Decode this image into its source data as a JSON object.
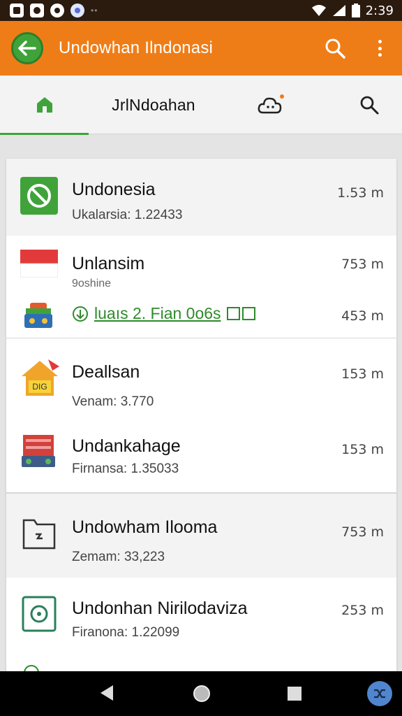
{
  "status_bar": {
    "time": "2:39"
  },
  "app_bar": {
    "title": "Undowhan Ilndonasi"
  },
  "tabs": {
    "label": "JrlNdoahan"
  },
  "items": [
    {
      "title": "Undonesia",
      "subtitle": "Ukalarsia: 1.22433",
      "size": "1.53 m"
    },
    {
      "title": "Unlansim",
      "subtitle": "9oshine",
      "size": "753 m"
    },
    {
      "link": "luaıs 2. Fian 0o6s",
      "size": "453 m"
    },
    {
      "title": "Deallsan",
      "subtitle": "Venam: 3.770",
      "size": "153 m"
    },
    {
      "title": "Undankahage",
      "subtitle": "Firnansa: 1.35033",
      "size": "153 m"
    },
    {
      "title": "Undowham Ilooma",
      "subtitle": "Zemam: 33,223",
      "size": "753 m"
    },
    {
      "title": "Undonhan Nirilodaviza",
      "subtitle": "Firanona: 1.22099",
      "size": "253 m"
    }
  ],
  "colors": {
    "accent": "#ef7d17",
    "primary_green": "#3fa33a",
    "link_green": "#2e8b2a",
    "status_bar": "#2b1a0e"
  }
}
